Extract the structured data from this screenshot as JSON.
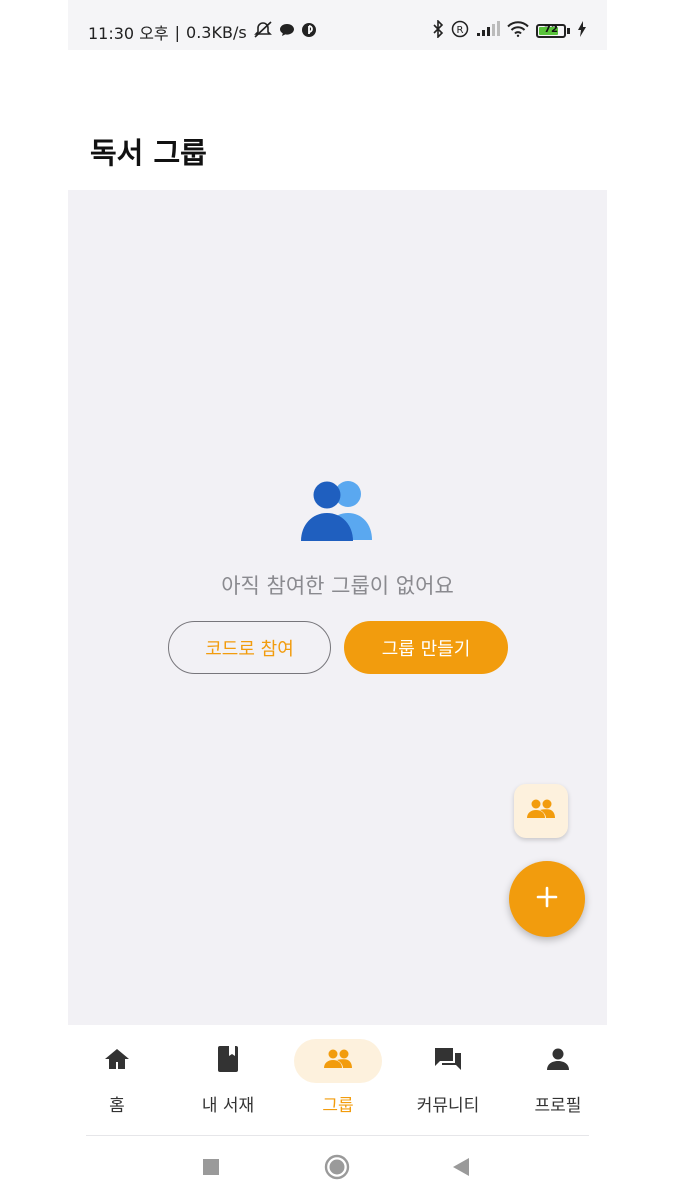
{
  "status_bar": {
    "time": "11:30 오후",
    "speed": "0.3KB/s",
    "battery_level": "72"
  },
  "header": {
    "title": "독서 그룹"
  },
  "empty_state": {
    "message": "아직 참여한 그룹이 없어요",
    "join_button": "코드로 참여",
    "create_button": "그룹 만들기"
  },
  "fab": {
    "main_icon": "plus-icon",
    "secondary_icon": "group-icon"
  },
  "bottom_nav": {
    "items": [
      {
        "label": "홈",
        "icon": "home-icon"
      },
      {
        "label": "내 서재",
        "icon": "book-icon"
      },
      {
        "label": "그룹",
        "icon": "group-icon",
        "active": true
      },
      {
        "label": "커뮤니티",
        "icon": "chat-icon"
      },
      {
        "label": "프로필",
        "icon": "person-icon"
      }
    ]
  },
  "colors": {
    "accent": "#f29c0d",
    "accent_light": "#fdf1dd",
    "content_bg": "#f2f1f5",
    "text_muted": "#8a8a8f"
  }
}
